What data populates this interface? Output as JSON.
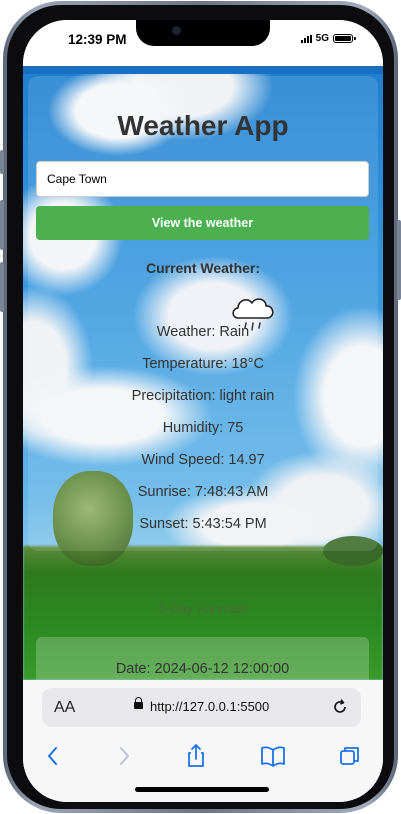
{
  "status_bar": {
    "time": "12:39 PM",
    "network": "5G"
  },
  "app": {
    "title": "Weather App",
    "city_input_value": "Cape Town",
    "view_button_label": "View the weather"
  },
  "current_weather": {
    "heading": "Current Weather:",
    "icon": "rain-cloud-icon",
    "weather": "Weather: Rain",
    "temperature": "Temperature: 18°C",
    "precipitation": "Precipitation: light rain",
    "humidity": "Humidity: 75",
    "wind_speed": "Wind Speed: 14.97",
    "sunrise": "Sunrise: 7:48:43 AM",
    "sunset": "Sunset: 5:43:54 PM"
  },
  "forecast": {
    "heading": "5-Day Forecast",
    "items": [
      {
        "date": "Date: 2024-06-12 12:00:00"
      }
    ]
  },
  "browser": {
    "text_size_label": "AA",
    "url": "http://127.0.0.1:5500"
  },
  "colors": {
    "primary_button": "#4caf50",
    "title_text": "#333333"
  }
}
